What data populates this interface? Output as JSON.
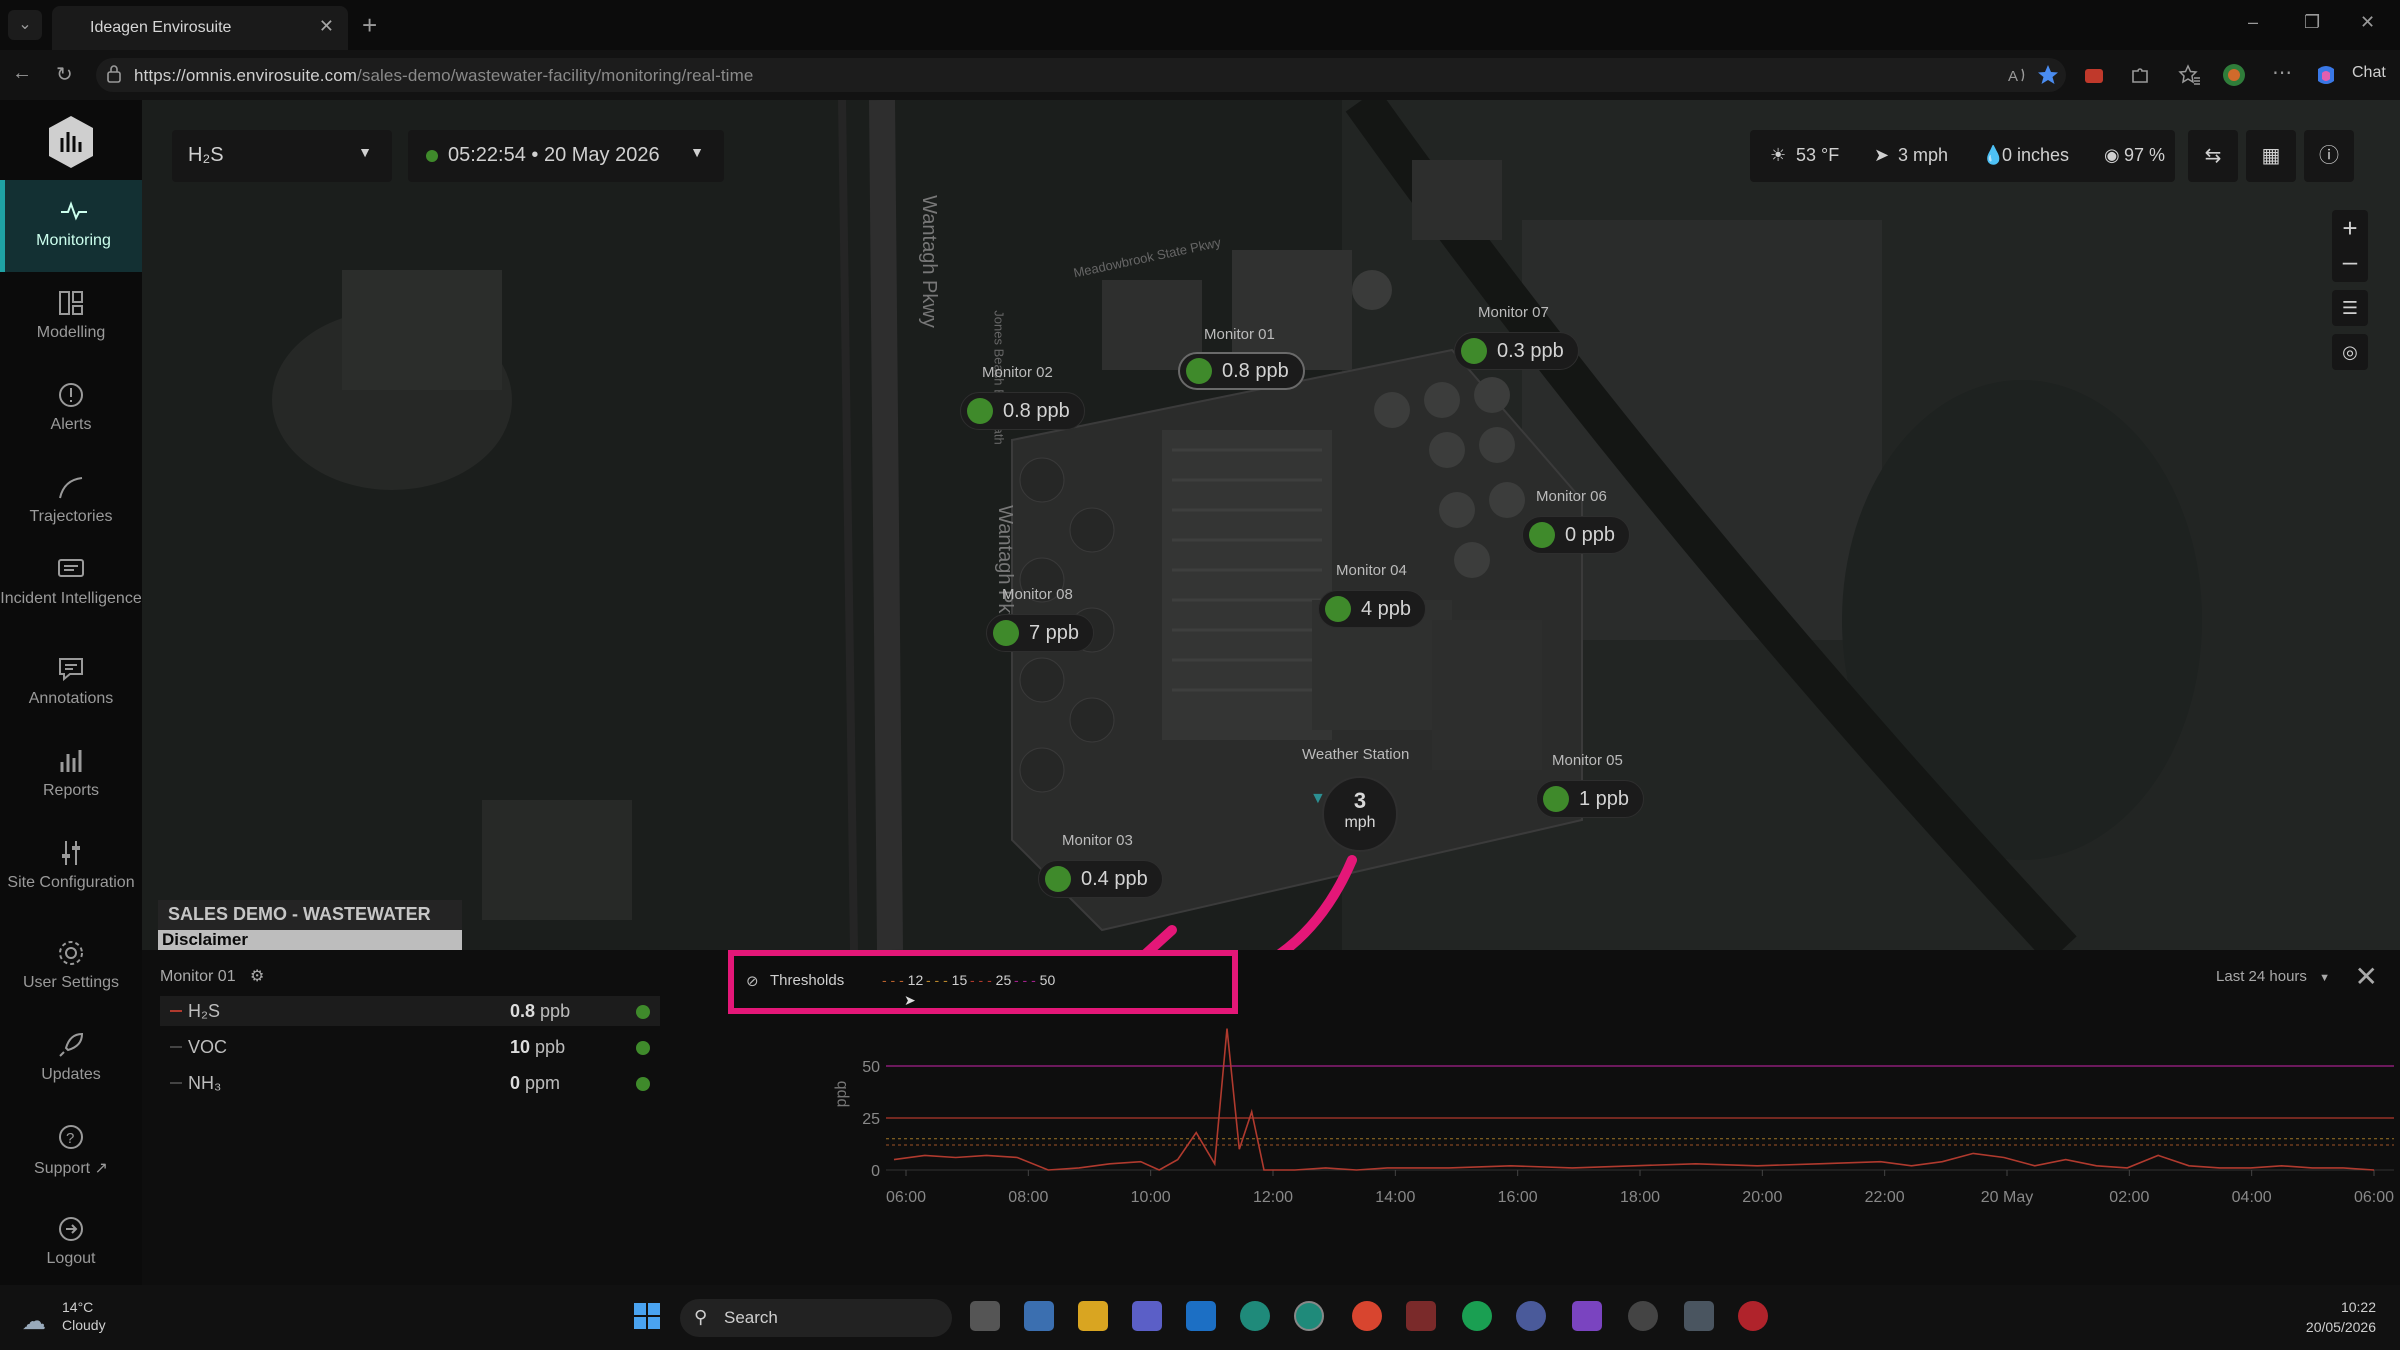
{
  "browser": {
    "tab_title": "Ideagen Envirosuite",
    "url_host": "https://omnis.envirosuite.com",
    "url_path": "/sales-demo/wastewater-facility/monitoring/real-time",
    "chat_label": "Chat"
  },
  "toolbar": {
    "pollutant": "H₂S",
    "time": "05:22:54 • 20 May 2026",
    "temperature": "53 °F",
    "wind": "3 mph",
    "rain": "0 inches",
    "humidity": "97 %"
  },
  "sidebar": {
    "items": [
      {
        "label": "Monitoring"
      },
      {
        "label": "Modelling"
      },
      {
        "label": "Alerts"
      },
      {
        "label": "Trajectories"
      },
      {
        "label": "Incident Intelligence"
      },
      {
        "label": "Annotations"
      },
      {
        "label": "Reports"
      },
      {
        "label": "Site Configuration"
      },
      {
        "label": "User Settings"
      },
      {
        "label": "Updates"
      },
      {
        "label": "Support"
      },
      {
        "label": "Logout"
      }
    ]
  },
  "map": {
    "monitors": [
      {
        "name": "Monitor 01",
        "value": "0.8 ppb"
      },
      {
        "name": "Monitor 02",
        "value": "0.8 ppb"
      },
      {
        "name": "Monitor 03",
        "value": "0.4 ppb"
      },
      {
        "name": "Monitor 04",
        "value": "4 ppb"
      },
      {
        "name": "Monitor 05",
        "value": "1 ppb"
      },
      {
        "name": "Monitor 06",
        "value": "0 ppb"
      },
      {
        "name": "Monitor 07",
        "value": "0.3 ppb"
      },
      {
        "name": "Monitor 08",
        "value": "7 ppb"
      }
    ],
    "weather_station": {
      "name": "Weather Station",
      "speed": "3",
      "unit": "mph"
    },
    "road_labels": [
      "Wantagh Pkwy",
      "Wantagh Pkwy",
      "Jones Beach Bike Path",
      "Meadowbrook State Pkwy"
    ],
    "site_title": "SALES DEMO - WASTEWATER",
    "disclaimer": "Disclaimer"
  },
  "panel": {
    "monitor_name": "Monitor 01",
    "rows": [
      {
        "name": "H₂S",
        "value": "0.8",
        "unit": "ppb"
      },
      {
        "name": "VOC",
        "value": "10",
        "unit": "ppb"
      },
      {
        "name": "NH₃",
        "value": "0",
        "unit": "ppm"
      }
    ],
    "thresholds_label": "Thresholds",
    "threshold_values": [
      "12",
      "15",
      "25",
      "50"
    ],
    "range_label": "Last 24 hours"
  },
  "chart_data": {
    "type": "line",
    "ylabel": "ppb",
    "ylim": [
      0,
      75
    ],
    "yticks": [
      0,
      25,
      50
    ],
    "xticks": [
      "06:00",
      "08:00",
      "10:00",
      "12:00",
      "14:00",
      "16:00",
      "18:00",
      "20:00",
      "22:00",
      "20 May",
      "02:00",
      "04:00",
      "06:00"
    ],
    "thresholds": [
      {
        "value": 12,
        "color": "#b8602c"
      },
      {
        "value": 15,
        "color": "#b8862c"
      },
      {
        "value": 25,
        "color": "#b0392c"
      },
      {
        "value": 50,
        "color": "#a0208a"
      }
    ],
    "series": [
      {
        "color": "#b03a2e",
        "x": [
          0,
          0.5,
          1,
          1.5,
          2,
          2.5,
          3,
          3.5,
          4,
          4.3,
          4.6,
          4.9,
          5.2,
          5.4,
          5.6,
          5.8,
          6.0,
          6.2,
          6.5,
          7,
          7.5,
          8,
          9,
          10,
          11,
          12,
          13,
          14,
          15,
          16,
          16.5,
          17,
          17.5,
          18,
          18.5,
          19,
          19.5,
          20,
          20.5,
          21,
          21.5,
          22,
          22.5,
          23,
          23.5,
          24
        ],
        "values": [
          5,
          7,
          6,
          7,
          6,
          0,
          1,
          3,
          4,
          0,
          5,
          18,
          3,
          68,
          10,
          28,
          0,
          0,
          0,
          1,
          0,
          1,
          1,
          2,
          1,
          2,
          3,
          2,
          3,
          4,
          2,
          4,
          8,
          6,
          2,
          5,
          2,
          1,
          7,
          2,
          1,
          1,
          2,
          1,
          1,
          0
        ]
      }
    ]
  }
}
